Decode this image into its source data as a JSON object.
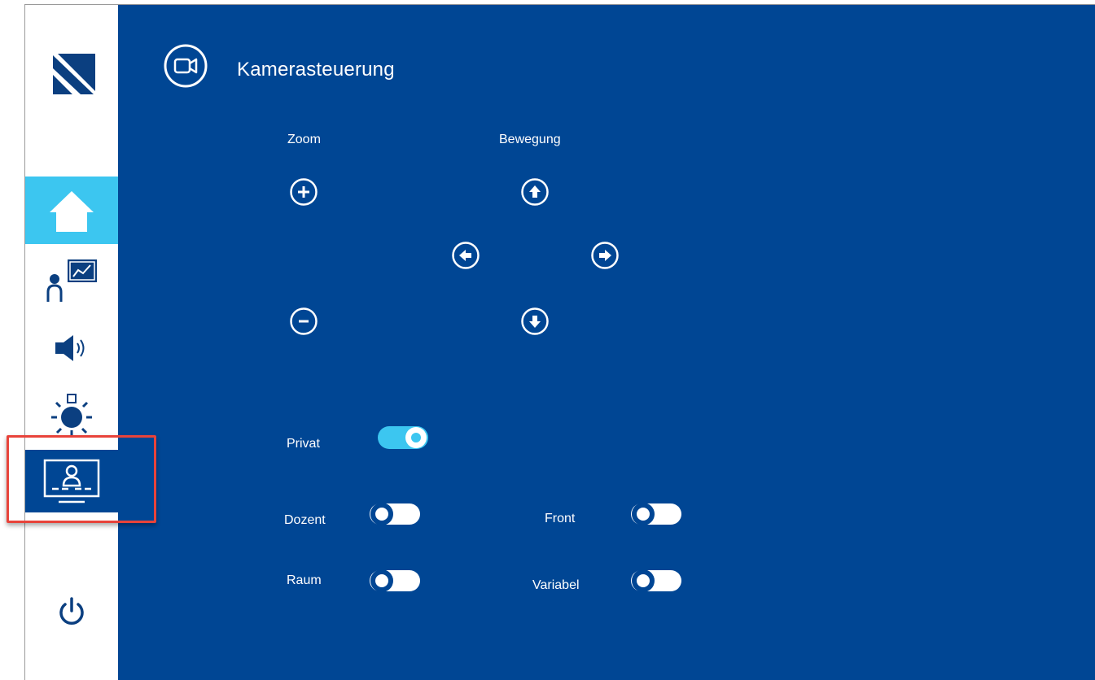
{
  "app": {
    "title": "Kamerasteuerung",
    "logo_icon": "brand-logo-icon",
    "colors": {
      "main_bg": "#004694",
      "sidebar_bg": "#ffffff",
      "active_nav": "#3cc6f0",
      "toggle_on": "#3cc6f0",
      "highlight": "#e8433a"
    }
  },
  "sidebar": {
    "items": [
      {
        "id": "home",
        "icon": "home-icon",
        "active": true
      },
      {
        "id": "presenter",
        "icon": "presenter-chart-icon",
        "active": false
      },
      {
        "id": "audio",
        "icon": "speaker-icon",
        "active": false
      },
      {
        "id": "light",
        "icon": "light-bulb-icon",
        "active": false
      },
      {
        "id": "camera",
        "icon": "camera-view-icon",
        "active": false,
        "highlighted": true
      },
      {
        "id": "power",
        "icon": "power-icon",
        "active": false
      }
    ]
  },
  "zoom": {
    "label": "Zoom",
    "in_icon": "plus-icon",
    "out_icon": "minus-icon"
  },
  "movement": {
    "label": "Bewegung",
    "up_icon": "arrow-up-icon",
    "down_icon": "arrow-down-icon",
    "left_icon": "arrow-left-icon",
    "right_icon": "arrow-right-icon"
  },
  "toggles": {
    "privat": {
      "label": "Privat",
      "on": true
    },
    "dozent": {
      "label": "Dozent",
      "on": false
    },
    "front": {
      "label": "Front",
      "on": false
    },
    "raum": {
      "label": "Raum",
      "on": false
    },
    "variabel": {
      "label": "Variabel",
      "on": false
    }
  }
}
